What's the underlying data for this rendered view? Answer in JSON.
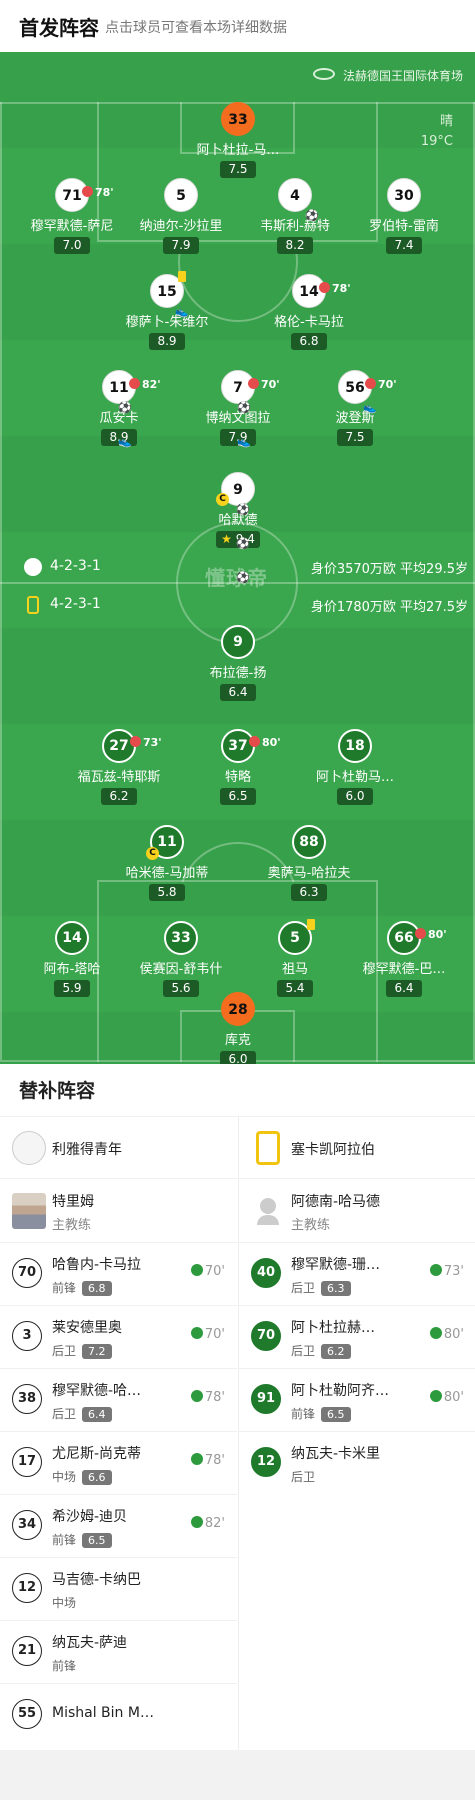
{
  "header": {
    "title": "首发阵容",
    "subtitle": "点击球员可查看本场详细数据"
  },
  "pitch": {
    "venue": "法赫德国王国际体育场",
    "weather": "晴",
    "temperature": "19°C",
    "logo_text": "懂球帝",
    "home_formation": "4-2-3-1",
    "home_value": "身价3570万欧 平均29.5岁",
    "away_formation": "4-2-3-1",
    "away_value": "身价1780万欧 平均27.5岁"
  },
  "home_players": [
    {
      "num": "33",
      "name": "阿卜杜拉-马…",
      "rating": "7.5"
    },
    {
      "num": "71",
      "name": "穆罕默德-萨尼",
      "rating": "7.0",
      "sub": "78'"
    },
    {
      "num": "5",
      "name": "纳迪尔-沙拉里",
      "rating": "7.9"
    },
    {
      "num": "4",
      "name": "韦斯利-赫特",
      "rating": "8.2"
    },
    {
      "num": "30",
      "name": "罗伯特-雷南",
      "rating": "7.4"
    },
    {
      "num": "15",
      "name": "穆萨卜-朱维尔",
      "rating": "8.9"
    },
    {
      "num": "14",
      "name": "格伦-卡马拉",
      "rating": "6.8",
      "sub": "78'"
    },
    {
      "num": "11",
      "name": "瓜安卡",
      "rating": "8.9",
      "sub": "82'"
    },
    {
      "num": "7",
      "name": "博纳文图拉",
      "rating": "7.9",
      "sub": "70'"
    },
    {
      "num": "56",
      "name": "波登斯",
      "rating": "7.5",
      "sub": "70'"
    },
    {
      "num": "9",
      "name": "哈默德",
      "rating": "9.4"
    }
  ],
  "away_players": [
    {
      "num": "9",
      "name": "布拉德-扬",
      "rating": "6.4"
    },
    {
      "num": "27",
      "name": "福瓦兹-特耶斯",
      "rating": "6.2",
      "sub": "73'"
    },
    {
      "num": "37",
      "name": "特略",
      "rating": "6.5",
      "sub": "80'"
    },
    {
      "num": "18",
      "name": "阿卜杜勒马…",
      "rating": "6.0"
    },
    {
      "num": "11",
      "name": "哈米德-马加蒂",
      "rating": "5.8"
    },
    {
      "num": "88",
      "name": "奥萨马-哈拉夫",
      "rating": "6.3"
    },
    {
      "num": "14",
      "name": "阿布-塔哈",
      "rating": "5.9"
    },
    {
      "num": "33",
      "name": "侯赛因-舒韦什",
      "rating": "5.6"
    },
    {
      "num": "5",
      "name": "祖马",
      "rating": "5.4"
    },
    {
      "num": "66",
      "name": "穆罕默德-巴…",
      "rating": "6.4",
      "sub": "80'"
    },
    {
      "num": "28",
      "name": "库克",
      "rating": "6.0"
    }
  ],
  "subs": {
    "title": "替补阵容",
    "home_team": "利雅得青年",
    "away_team": "塞卡凯阿拉伯",
    "home_coach": "特里姆",
    "away_coach": "阿德南-哈马德",
    "coach_role": "主教练",
    "home": [
      {
        "num": "70",
        "name": "哈鲁内-卡马拉",
        "pos": "前锋",
        "rating": "6.8",
        "time": "70'"
      },
      {
        "num": "3",
        "name": "莱安德里奥",
        "pos": "后卫",
        "rating": "7.2",
        "time": "70'"
      },
      {
        "num": "38",
        "name": "穆罕默德-哈…",
        "pos": "后卫",
        "rating": "6.4",
        "time": "78'"
      },
      {
        "num": "17",
        "name": "尤尼斯-尚克蒂",
        "pos": "中场",
        "rating": "6.6",
        "time": "78'"
      },
      {
        "num": "34",
        "name": "希沙姆-迪贝",
        "pos": "前锋",
        "rating": "6.5",
        "time": "82'"
      },
      {
        "num": "12",
        "name": "马吉德-卡纳巴",
        "pos": "中场"
      },
      {
        "num": "21",
        "name": "纳瓦夫-萨迪",
        "pos": "前锋"
      },
      {
        "num": "55",
        "name": "Mishal Bin M…"
      }
    ],
    "away": [
      {
        "num": "40",
        "name": "穆罕默德-珊…",
        "pos": "后卫",
        "rating": "6.3",
        "time": "73'"
      },
      {
        "num": "70",
        "name": "阿卜杜拉赫…",
        "pos": "后卫",
        "rating": "6.2",
        "time": "80'"
      },
      {
        "num": "91",
        "name": "阿卜杜勒阿齐…",
        "pos": "前锋",
        "rating": "6.5",
        "time": "80'"
      },
      {
        "num": "12",
        "name": "纳瓦夫-卡米里",
        "pos": "后卫"
      }
    ]
  }
}
